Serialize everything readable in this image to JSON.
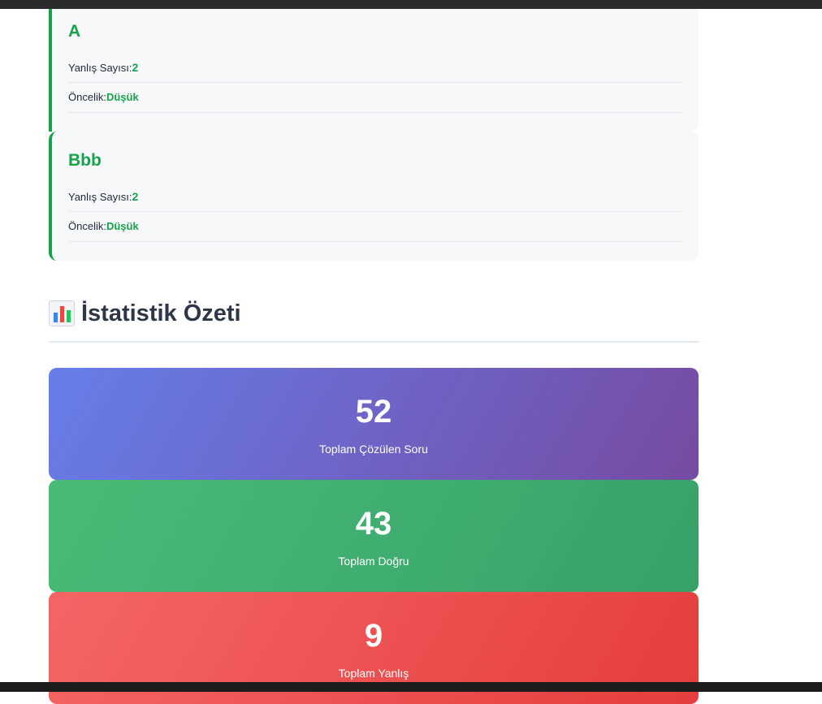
{
  "topics": [
    {
      "name": "A",
      "wrong_label": "Yanlış Sayısı:",
      "wrong_value": "2",
      "priority_label": "Öncelik:",
      "priority_value": "Düşük"
    },
    {
      "name": "Bbb",
      "wrong_label": "Yanlış Sayısı:",
      "wrong_value": "2",
      "priority_label": "Öncelik:",
      "priority_value": "Düşük"
    }
  ],
  "stats": {
    "icon": "bar-chart-icon",
    "title": "İstatistik Özeti",
    "cards": [
      {
        "value": "52",
        "label": "Toplam Çözülen Soru",
        "color": "#6b72dd"
      },
      {
        "value": "43",
        "label": "Toplam Doğru",
        "color": "#48bb78"
      },
      {
        "value": "9",
        "label": "Toplam Yanlış",
        "color": "#f56565"
      }
    ]
  },
  "colors": {
    "accent_green": "#16a34a",
    "heading": "#2d3748"
  }
}
